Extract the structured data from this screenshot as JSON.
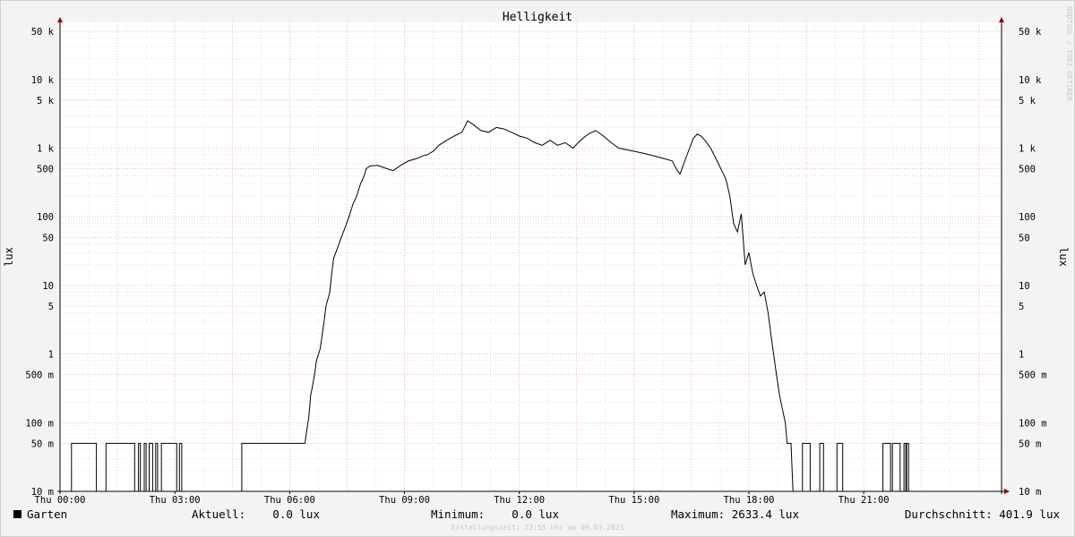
{
  "chart_data": {
    "type": "line",
    "title": "Helligkeit",
    "ylabel": "lux",
    "yscale": "log",
    "ylim": [
      0.01,
      70000
    ],
    "xlim": [
      0,
      24.6
    ],
    "x_ticks": [
      {
        "x": 0,
        "label": "Thu 00:00"
      },
      {
        "x": 3,
        "label": "Thu 03:00"
      },
      {
        "x": 6,
        "label": "Thu 06:00"
      },
      {
        "x": 9,
        "label": "Thu 09:00"
      },
      {
        "x": 12,
        "label": "Thu 12:00"
      },
      {
        "x": 15,
        "label": "Thu 15:00"
      },
      {
        "x": 18,
        "label": "Thu 18:00"
      },
      {
        "x": 21,
        "label": "Thu 21:00"
      }
    ],
    "y_ticks": [
      {
        "y": 0.01,
        "label": "10 m"
      },
      {
        "y": 0.05,
        "label": "50 m"
      },
      {
        "y": 0.1,
        "label": "100 m"
      },
      {
        "y": 0.5,
        "label": "500 m"
      },
      {
        "y": 1,
        "label": "1"
      },
      {
        "y": 5,
        "label": "5"
      },
      {
        "y": 10,
        "label": "10"
      },
      {
        "y": 50,
        "label": "50"
      },
      {
        "y": 100,
        "label": "100"
      },
      {
        "y": 500,
        "label": "500"
      },
      {
        "y": 1000,
        "label": "1 k"
      },
      {
        "y": 5000,
        "label": "5 k"
      },
      {
        "y": 10000,
        "label": "10 k"
      },
      {
        "y": 50000,
        "label": "50 k"
      }
    ],
    "series": [
      {
        "name": "Garten",
        "color": "#000000",
        "points": [
          [
            0.0,
            0.01
          ],
          [
            0.3,
            0.01
          ],
          [
            0.3,
            0.05
          ],
          [
            0.95,
            0.05
          ],
          [
            0.95,
            0.01
          ],
          [
            1.2,
            0.01
          ],
          [
            1.2,
            0.05
          ],
          [
            1.95,
            0.05
          ],
          [
            1.95,
            0.01
          ],
          [
            2.05,
            0.01
          ],
          [
            2.05,
            0.05
          ],
          [
            2.1,
            0.05
          ],
          [
            2.1,
            0.01
          ],
          [
            2.2,
            0.01
          ],
          [
            2.2,
            0.05
          ],
          [
            2.25,
            0.05
          ],
          [
            2.25,
            0.01
          ],
          [
            2.33,
            0.01
          ],
          [
            2.33,
            0.05
          ],
          [
            2.42,
            0.05
          ],
          [
            2.42,
            0.01
          ],
          [
            2.5,
            0.01
          ],
          [
            2.5,
            0.05
          ],
          [
            2.55,
            0.05
          ],
          [
            2.55,
            0.01
          ],
          [
            2.65,
            0.01
          ],
          [
            2.65,
            0.05
          ],
          [
            3.05,
            0.05
          ],
          [
            3.05,
            0.01
          ],
          [
            3.12,
            0.01
          ],
          [
            3.12,
            0.05
          ],
          [
            3.18,
            0.05
          ],
          [
            3.18,
            0.01
          ],
          [
            4.75,
            0.01
          ],
          [
            4.75,
            0.05
          ],
          [
            6.4,
            0.05
          ],
          [
            6.45,
            0.08
          ],
          [
            6.5,
            0.12
          ],
          [
            6.55,
            0.25
          ],
          [
            6.6,
            0.35
          ],
          [
            6.65,
            0.5
          ],
          [
            6.7,
            0.8
          ],
          [
            6.8,
            1.2
          ],
          [
            6.9,
            3
          ],
          [
            6.95,
            5
          ],
          [
            7.05,
            8
          ],
          [
            7.1,
            15
          ],
          [
            7.15,
            25
          ],
          [
            7.25,
            35
          ],
          [
            7.35,
            50
          ],
          [
            7.45,
            70
          ],
          [
            7.55,
            100
          ],
          [
            7.65,
            150
          ],
          [
            7.75,
            200
          ],
          [
            7.85,
            300
          ],
          [
            7.95,
            400
          ],
          [
            8.0,
            500
          ],
          [
            8.1,
            550
          ],
          [
            8.3,
            560
          ],
          [
            8.5,
            510
          ],
          [
            8.7,
            470
          ],
          [
            8.9,
            560
          ],
          [
            9.1,
            650
          ],
          [
            9.3,
            700
          ],
          [
            9.5,
            780
          ],
          [
            9.6,
            800
          ],
          [
            9.75,
            900
          ],
          [
            9.9,
            1100
          ],
          [
            10.1,
            1300
          ],
          [
            10.3,
            1500
          ],
          [
            10.5,
            1700
          ],
          [
            10.65,
            2500
          ],
          [
            10.8,
            2200
          ],
          [
            11.0,
            1800
          ],
          [
            11.2,
            1700
          ],
          [
            11.4,
            2000
          ],
          [
            11.6,
            1900
          ],
          [
            11.8,
            1700
          ],
          [
            12.0,
            1500
          ],
          [
            12.2,
            1400
          ],
          [
            12.4,
            1200
          ],
          [
            12.6,
            1100
          ],
          [
            12.8,
            1300
          ],
          [
            13.0,
            1100
          ],
          [
            13.2,
            1200
          ],
          [
            13.4,
            1000
          ],
          [
            13.6,
            1300
          ],
          [
            13.8,
            1600
          ],
          [
            14.0,
            1800
          ],
          [
            14.2,
            1500
          ],
          [
            14.4,
            1200
          ],
          [
            14.6,
            1000
          ],
          [
            14.8,
            950
          ],
          [
            15.0,
            900
          ],
          [
            15.2,
            850
          ],
          [
            15.4,
            800
          ],
          [
            15.6,
            750
          ],
          [
            15.8,
            700
          ],
          [
            16.0,
            650
          ],
          [
            16.1,
            500
          ],
          [
            16.2,
            420
          ],
          [
            16.3,
            600
          ],
          [
            16.45,
            1000
          ],
          [
            16.55,
            1400
          ],
          [
            16.65,
            1600
          ],
          [
            16.75,
            1500
          ],
          [
            16.85,
            1300
          ],
          [
            17.0,
            1000
          ],
          [
            17.2,
            600
          ],
          [
            17.4,
            350
          ],
          [
            17.5,
            200
          ],
          [
            17.6,
            80
          ],
          [
            17.7,
            60
          ],
          [
            17.8,
            110
          ],
          [
            17.9,
            20
          ],
          [
            18.0,
            30
          ],
          [
            18.1,
            15
          ],
          [
            18.2,
            10
          ],
          [
            18.3,
            7
          ],
          [
            18.4,
            8
          ],
          [
            18.5,
            4
          ],
          [
            18.6,
            1.5
          ],
          [
            18.7,
            0.6
          ],
          [
            18.8,
            0.25
          ],
          [
            18.95,
            0.1
          ],
          [
            19.0,
            0.05
          ],
          [
            19.1,
            0.05
          ],
          [
            19.15,
            0.01
          ],
          [
            19.4,
            0.01
          ],
          [
            19.4,
            0.05
          ],
          [
            19.6,
            0.05
          ],
          [
            19.6,
            0.01
          ],
          [
            19.85,
            0.01
          ],
          [
            19.85,
            0.05
          ],
          [
            19.95,
            0.05
          ],
          [
            19.95,
            0.01
          ],
          [
            20.3,
            0.01
          ],
          [
            20.3,
            0.05
          ],
          [
            20.45,
            0.05
          ],
          [
            20.45,
            0.01
          ],
          [
            21.5,
            0.01
          ],
          [
            21.5,
            0.05
          ],
          [
            21.7,
            0.05
          ],
          [
            21.7,
            0.01
          ],
          [
            21.75,
            0.01
          ],
          [
            21.75,
            0.05
          ],
          [
            21.95,
            0.05
          ],
          [
            21.95,
            0.01
          ],
          [
            22.05,
            0.01
          ],
          [
            22.05,
            0.05
          ],
          [
            22.1,
            0.05
          ],
          [
            22.1,
            0.01
          ],
          [
            22.12,
            0.01
          ],
          [
            22.12,
            0.05
          ],
          [
            22.17,
            0.05
          ],
          [
            22.17,
            0.01
          ],
          [
            24.0,
            0.01
          ]
        ]
      }
    ]
  },
  "legend": {
    "swatch_color": "#000000",
    "series_name": "Garten",
    "current": "Aktuell:    0.0 lux",
    "minimum": "Minimum:    0.0 lux",
    "maximum": "Maximum: 2633.4 lux",
    "average": "Durchschnitt: 401.9 lux"
  },
  "watermark": "RRDTOOL / TOBI OETIKER",
  "footer": "Erstellungszeit: 23:55 Uhr am 09.03.2023"
}
